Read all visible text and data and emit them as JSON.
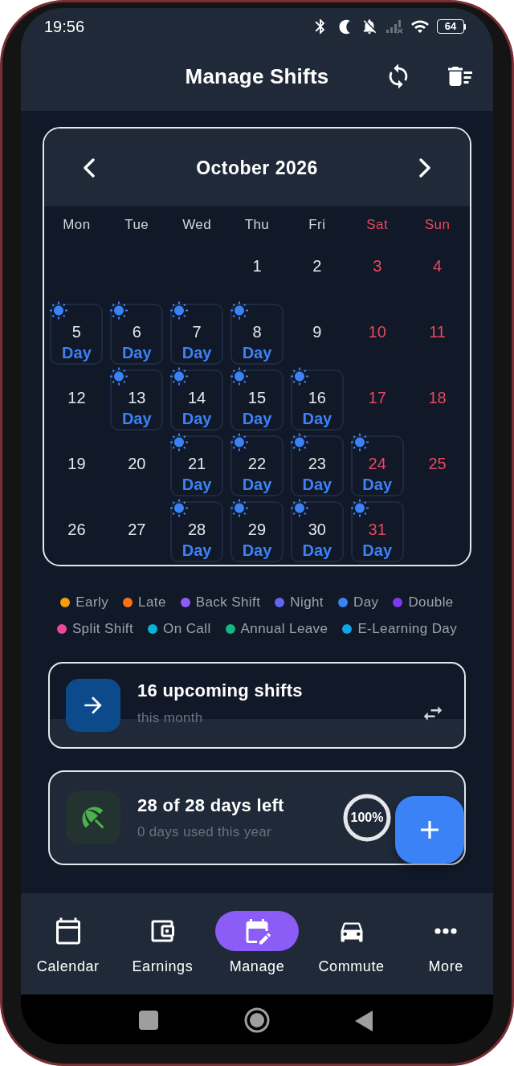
{
  "status_bar": {
    "time": "19:56",
    "battery": "64"
  },
  "app_bar": {
    "title": "Manage Shifts"
  },
  "calendar": {
    "month": "October 2026",
    "weekdays": [
      {
        "label": "Mon",
        "weekend": false
      },
      {
        "label": "Tue",
        "weekend": false
      },
      {
        "label": "Wed",
        "weekend": false
      },
      {
        "label": "Thu",
        "weekend": false
      },
      {
        "label": "Fri",
        "weekend": false
      },
      {
        "label": "Sat",
        "weekend": true
      },
      {
        "label": "Sun",
        "weekend": true
      }
    ],
    "weeks": [
      [
        {
          "day": "1",
          "weekend": false
        },
        {
          "day": "2",
          "weekend": false
        },
        {
          "day": "3",
          "weekend": true
        },
        {
          "day": "4",
          "weekend": true
        }
      ],
      [
        {
          "day": "5",
          "weekend": false,
          "shift": {
            "kind": "day",
            "label": "Day",
            "color": "#3b82f6"
          }
        },
        {
          "day": "6",
          "weekend": false,
          "shift": {
            "kind": "day",
            "label": "Day",
            "color": "#3b82f6"
          }
        },
        {
          "day": "7",
          "weekend": false,
          "shift": {
            "kind": "day",
            "label": "Day",
            "color": "#3b82f6"
          }
        },
        {
          "day": "8",
          "weekend": false,
          "shift": {
            "kind": "day",
            "label": "Day",
            "color": "#3b82f6"
          }
        },
        {
          "day": "9",
          "weekend": false
        },
        {
          "day": "10",
          "weekend": true
        },
        {
          "day": "11",
          "weekend": true
        }
      ],
      [
        {
          "day": "12",
          "weekend": false
        },
        {
          "day": "13",
          "weekend": false,
          "shift": {
            "kind": "day",
            "label": "Day",
            "color": "#3b82f6"
          }
        },
        {
          "day": "14",
          "weekend": false,
          "shift": {
            "kind": "day",
            "label": "Day",
            "color": "#3b82f6"
          }
        },
        {
          "day": "15",
          "weekend": false,
          "shift": {
            "kind": "day",
            "label": "Day",
            "color": "#3b82f6"
          }
        },
        {
          "day": "16",
          "weekend": false,
          "shift": {
            "kind": "day",
            "label": "Day",
            "color": "#3b82f6"
          }
        },
        {
          "day": "17",
          "weekend": true
        },
        {
          "day": "18",
          "weekend": true
        }
      ],
      [
        {
          "day": "19",
          "weekend": false
        },
        {
          "day": "20",
          "weekend": false
        },
        {
          "day": "21",
          "weekend": false,
          "shift": {
            "kind": "day",
            "label": "Day",
            "color": "#3b82f6"
          }
        },
        {
          "day": "22",
          "weekend": false,
          "shift": {
            "kind": "day",
            "label": "Day",
            "color": "#3b82f6"
          }
        },
        {
          "day": "23",
          "weekend": false,
          "shift": {
            "kind": "day",
            "label": "Day",
            "color": "#3b82f6"
          }
        },
        {
          "day": "24",
          "weekend": true,
          "shift": {
            "kind": "day",
            "label": "Day",
            "color": "#3b82f6"
          }
        },
        {
          "day": "25",
          "weekend": true
        }
      ],
      [
        {
          "day": "26",
          "weekend": false
        },
        {
          "day": "27",
          "weekend": false
        },
        {
          "day": "28",
          "weekend": false,
          "shift": {
            "kind": "day",
            "label": "Day",
            "color": "#3b82f6"
          }
        },
        {
          "day": "29",
          "weekend": false,
          "shift": {
            "kind": "day",
            "label": "Day",
            "color": "#3b82f6"
          }
        },
        {
          "day": "30",
          "weekend": false,
          "shift": {
            "kind": "day",
            "label": "Day",
            "color": "#3b82f6"
          }
        },
        {
          "day": "31",
          "weekend": true,
          "shift": {
            "kind": "day",
            "label": "Day",
            "color": "#3b82f6"
          }
        }
      ]
    ]
  },
  "legend": [
    {
      "label": "Early",
      "color": "#f59e0b"
    },
    {
      "label": "Late",
      "color": "#f97316"
    },
    {
      "label": "Back Shift",
      "color": "#8b5cf6"
    },
    {
      "label": "Night",
      "color": "#6366f1"
    },
    {
      "label": "Day",
      "color": "#3b82f6"
    },
    {
      "label": "Double",
      "color": "#7c3aed"
    },
    {
      "label": "Split Shift",
      "color": "#ec4899"
    },
    {
      "label": "On Call",
      "color": "#06b6d4"
    },
    {
      "label": "Annual Leave",
      "color": "#10b981"
    },
    {
      "label": "E-Learning Day",
      "color": "#0ea5e9"
    }
  ],
  "upcoming_card": {
    "title": "16 upcoming shifts",
    "subtitle": "this month"
  },
  "leave_card": {
    "title": "28 of 28 days left",
    "subtitle": "0 days used this year",
    "progress": {
      "level": 1,
      "label": "100%"
    }
  },
  "nav": {
    "items": [
      {
        "label": "Calendar",
        "selected": false
      },
      {
        "label": "Earnings",
        "selected": false
      },
      {
        "label": "Manage",
        "selected": true
      },
      {
        "label": "Commute",
        "selected": false
      },
      {
        "label": "More",
        "selected": false
      }
    ]
  }
}
